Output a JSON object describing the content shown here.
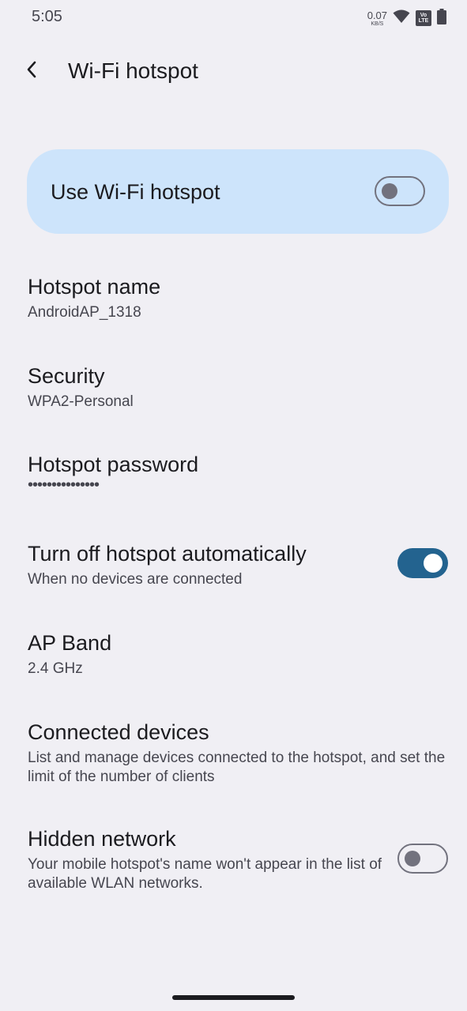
{
  "status_bar": {
    "time": "5:05",
    "net_speed_value": "0.07",
    "net_speed_unit": "KB/S",
    "volte_top": "Vo",
    "volte_bottom": "LTE",
    "icons": [
      "wifi-signal-icon",
      "volte-lte-icon",
      "battery-icon"
    ]
  },
  "app_bar": {
    "back_icon": "back-arrow-icon",
    "title": "Wi-Fi hotspot"
  },
  "main_switch": {
    "label": "Use Wi-Fi hotspot",
    "checked": false
  },
  "preferences": {
    "hotspot_name": {
      "title": "Hotspot name",
      "summary": "AndroidAP_1318"
    },
    "security": {
      "title": "Security",
      "summary": "WPA2-Personal"
    },
    "hotspot_password": {
      "title": "Hotspot password",
      "summary": "•••••••••••••••"
    },
    "auto_turn_off": {
      "title": "Turn off hotspot automatically",
      "summary": "When no devices are connected",
      "checked": true
    },
    "ap_band": {
      "title": "AP Band",
      "summary": "2.4 GHz"
    },
    "connected_devices": {
      "title": "Connected devices",
      "summary": "List and manage devices connected to the hotspot, and set the limit of the number of clients"
    },
    "hidden_network": {
      "title": "Hidden network",
      "summary": "Your mobile hotspot's name won't appear in the list of available WLAN networks.",
      "checked": false
    }
  },
  "colors": {
    "background": "#f0eff4",
    "main_switch_card": "#cde4fb",
    "toggle_on": "#23638f",
    "toggle_off_outline": "#72727e",
    "primary_text": "#1b1b1f",
    "secondary_text": "#46464f"
  }
}
